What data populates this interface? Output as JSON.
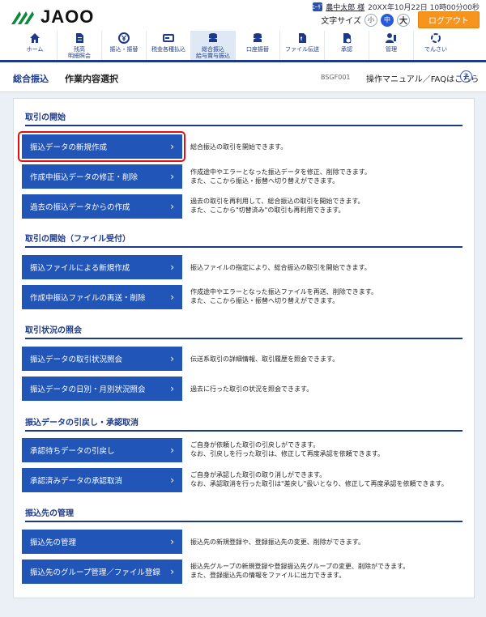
{
  "header": {
    "logo_text": "JAOO",
    "user_icon_label": "ﾕｰｻﾞ",
    "user_name": "農中太郎 様",
    "datetime": "20XX年10月22日 10時00分00秒",
    "font_size_label": "文字サイズ",
    "font_small": "小",
    "font_medium": "中",
    "font_large": "大",
    "logout": "ログアウト"
  },
  "nav": [
    {
      "label": "ホーム",
      "icon": "home-icon"
    },
    {
      "label": "残高\n明細照会",
      "icon": "document-icon"
    },
    {
      "label": "振込・振替",
      "icon": "yen-icon"
    },
    {
      "label": "税金各種払込",
      "icon": "payment-icon"
    },
    {
      "label": "総合振込\n給与賞与振込",
      "icon": "coins-icon"
    },
    {
      "label": "口座振替",
      "icon": "coins-icon"
    },
    {
      "label": "ファイル伝送",
      "icon": "file-icon"
    },
    {
      "label": "承認",
      "icon": "approve-icon"
    },
    {
      "label": "管理",
      "icon": "manage-icon"
    },
    {
      "label": "でんさい",
      "icon": "densai-icon"
    }
  ],
  "titlebar": {
    "category": "総合振込",
    "title": "作業内容選択",
    "code": "BSGF001",
    "help": "操作マニュアル／FAQはこちら",
    "help_icon": "?"
  },
  "sections": [
    {
      "heading": "取引の開始",
      "items": [
        {
          "label": "振込データの新規作成",
          "desc": "総合振込の取引を開始できます。"
        },
        {
          "label": "作成中振込データの修正・削除",
          "desc": "作成途中やエラーとなった振込データを修正、削除できます。\nまた、ここから振込・振替へ切り替えができます。"
        },
        {
          "label": "過去の振込データからの作成",
          "desc": "過去の取引を再利用して、総合振込の取引を開始できます。\nまた、ここから\"切替済み\"の取引も再利用できます。"
        }
      ]
    },
    {
      "heading": "取引の開始（ファイル受付）",
      "items": [
        {
          "label": "振込ファイルによる新規作成",
          "desc": "振込ファイルの指定により、総合振込の取引を開始できます。"
        },
        {
          "label": "作成中振込ファイルの再送・削除",
          "desc": "作成途中やエラーとなった振込ファイルを再送、削除できます。\nまた、ここから振込・振替へ切り替えができます。"
        }
      ]
    },
    {
      "heading": "取引状況の照会",
      "items": [
        {
          "label": "振込データの取引状況照会",
          "desc": "伝送系取引の詳細情報、取引履歴を照会できます。"
        },
        {
          "label": "振込データの日別・月別状況照会",
          "desc": "過去に行った取引の状況を照会できます。"
        }
      ]
    },
    {
      "heading": "振込データの引戻し・承認取消",
      "items": [
        {
          "label": "承認待ちデータの引戻し",
          "desc": "ご自身が依頼した取引の引戻しができます。\nなお、引戻しを行った取引は、修正して再度承認を依頼できます。"
        },
        {
          "label": "承認済みデータの承認取消",
          "desc": "ご自身が承認した取引の取り消しができます。\nなお、承認取消を行った取引は\"差戻し\"扱いとなり、修正して再度承認を依頼できます。"
        }
      ]
    },
    {
      "heading": "振込先の管理",
      "items": [
        {
          "label": "振込先の管理",
          "desc": "振込先の新規登録や、登録振込先の変更、削除ができます。"
        },
        {
          "label": "振込先のグループ管理／ファイル登録",
          "desc": "振込先グループの新規登録や登録振込先グループの変更、削除ができます。\nまた、登録振込先の情報をファイルに出力できます。"
        }
      ]
    }
  ],
  "chevron": "›"
}
